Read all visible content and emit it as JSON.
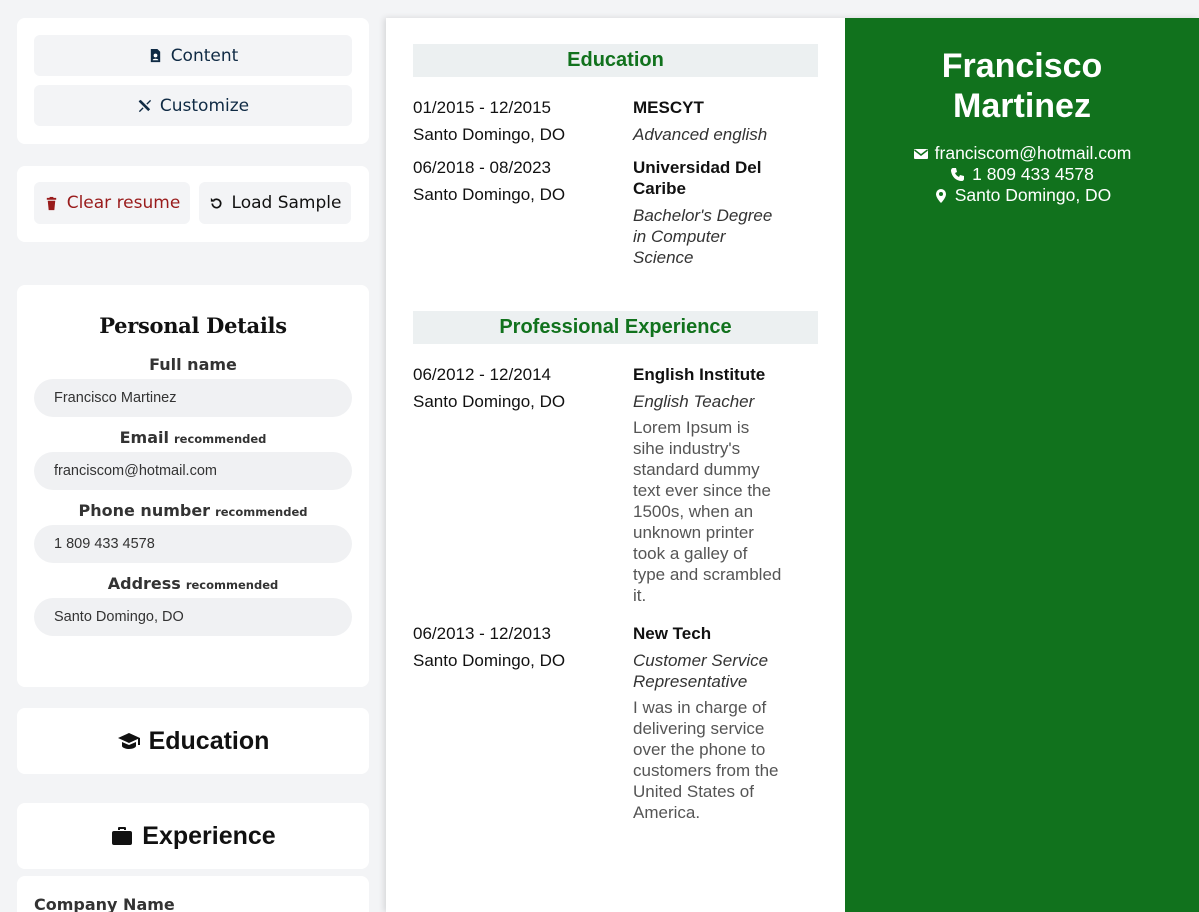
{
  "nav": {
    "content_label": "Content",
    "customize_label": "Customize"
  },
  "actions": {
    "clear_label": "Clear resume",
    "load_label": "Load Sample"
  },
  "personal": {
    "title": "Personal Details",
    "fields": [
      {
        "label": "Full name",
        "badge": "",
        "value": "Francisco Martinez"
      },
      {
        "label": "Email",
        "badge": "recommended",
        "value": "franciscom@hotmail.com"
      },
      {
        "label": "Phone number",
        "badge": "recommended",
        "value": "1 809 433 4578"
      },
      {
        "label": "Address",
        "badge": "recommended",
        "value": "Santo Domingo, DO"
      }
    ]
  },
  "sections": {
    "education_label": "Education",
    "experience_label": "Experience",
    "company_label": "Company Name"
  },
  "resume": {
    "name": "Francisco Martinez",
    "email": "franciscom@hotmail.com",
    "phone": "1 809 433 4578",
    "address": "Santo Domingo, DO",
    "education_heading": "Education",
    "experience_heading": "Professional Experience",
    "education": [
      {
        "dates": "01/2015 - 12/2015",
        "location": "Santo Domingo, DO",
        "school": "MESCYT",
        "degree": "Advanced english"
      },
      {
        "dates": "06/2018 - 08/2023",
        "location": "Santo Domingo, DO",
        "school": "Universidad Del Caribe",
        "degree": "Bachelor's Degree in Computer Science"
      }
    ],
    "experience": [
      {
        "dates": "06/2012 - 12/2014",
        "location": "Santo Domingo, DO",
        "company": "English Institute",
        "position": "English Teacher",
        "description": "Lorem Ipsum is sihe industry's standard dummy text ever since the 1500s, when an unknown printer took a galley of type and scrambled it."
      },
      {
        "dates": "06/2013 - 12/2013",
        "location": "Santo Domingo, DO",
        "company": "New Tech",
        "position": "Customer Service Representative",
        "description": "I was in charge of delivering service over the phone to customers from the United States of America."
      }
    ]
  },
  "colors": {
    "accent_green": "#11721d",
    "danger_red": "#991b1b",
    "nav_text": "#0f2a44"
  }
}
